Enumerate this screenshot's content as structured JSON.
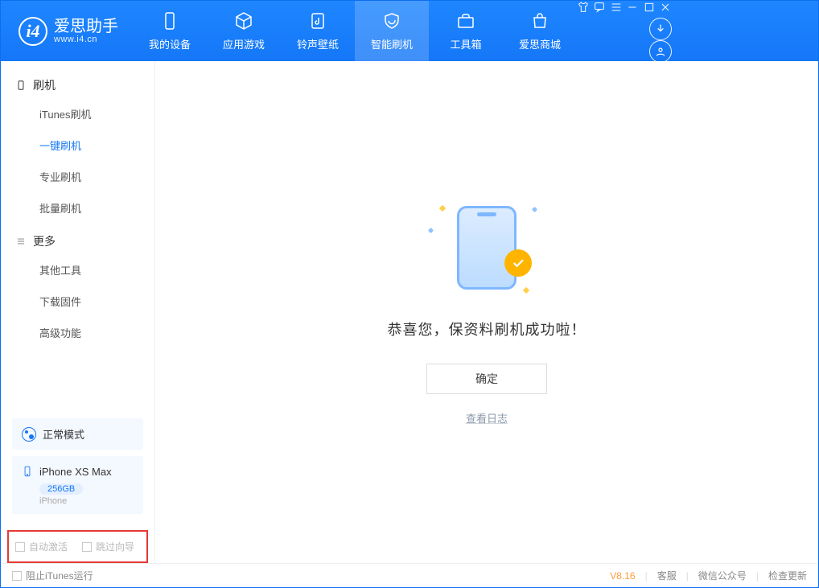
{
  "app": {
    "name_cn": "爱思助手",
    "name_en": "www.i4.cn",
    "logo_letter": "i4"
  },
  "tabs": [
    {
      "label": "我的设备"
    },
    {
      "label": "应用游戏"
    },
    {
      "label": "铃声壁纸"
    },
    {
      "label": "智能刷机",
      "active": true
    },
    {
      "label": "工具箱"
    },
    {
      "label": "爱思商城"
    }
  ],
  "sidebar": {
    "sections": [
      {
        "title": "刷机",
        "icon": "phone-icon",
        "items": [
          "iTunes刷机",
          "一键刷机",
          "专业刷机",
          "批量刷机"
        ],
        "active_index": 1
      },
      {
        "title": "更多",
        "icon": "menu-icon",
        "items": [
          "其他工具",
          "下载固件",
          "高级功能"
        ]
      }
    ],
    "mode_text": "正常模式",
    "device": {
      "name": "iPhone XS Max",
      "capacity": "256GB",
      "type": "iPhone"
    },
    "checkbox_auto_activate": "自动激活",
    "checkbox_skip_guide": "跳过向导"
  },
  "main": {
    "success_text": "恭喜您，保资料刷机成功啦！",
    "ok_button": "确定",
    "view_log": "查看日志"
  },
  "statusbar": {
    "block_itunes": "阻止iTunes运行",
    "version": "V8.16",
    "links": [
      "客服",
      "微信公众号",
      "检查更新"
    ]
  }
}
